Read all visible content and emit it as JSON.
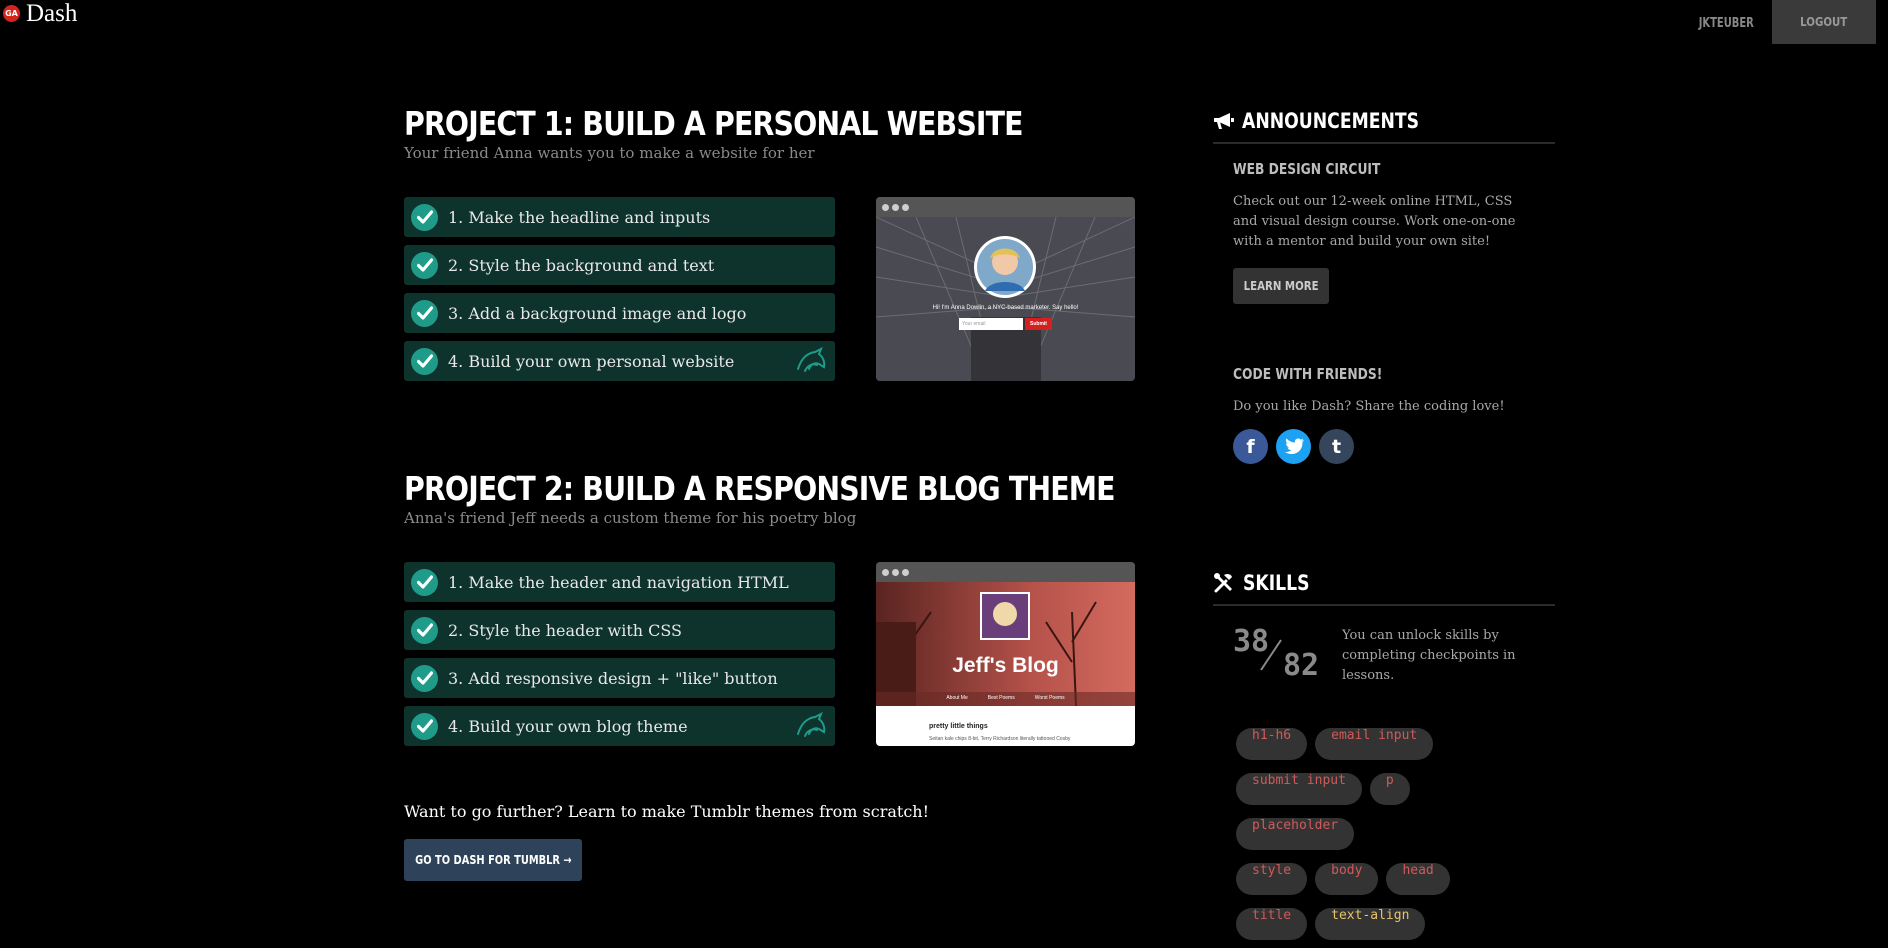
{
  "header": {
    "logo_badge": "GA",
    "logo_text": "Dash",
    "username": "JKTEUBER",
    "logout_label": "LOGOUT"
  },
  "projects": [
    {
      "title": "PROJECT 1: BUILD A PERSONAL WEBSITE",
      "subtitle": "Your friend Anna wants you to make a website for her",
      "steps": [
        {
          "label": "1. Make the headline and inputs",
          "completed": true
        },
        {
          "label": "2. Style the background and text",
          "completed": true
        },
        {
          "label": "3. Add a background image and logo",
          "completed": true
        },
        {
          "label": "4. Build your own personal website",
          "completed": true
        }
      ],
      "preview": {
        "tagline": "Hi! I'm Anna Dowlin, a NYC-based marketer. Say hello!",
        "email_placeholder": "Your email",
        "submit_label": "Submit"
      }
    },
    {
      "title": "PROJECT 2: BUILD A RESPONSIVE BLOG THEME",
      "subtitle": "Anna's friend Jeff needs a custom theme for his poetry blog",
      "steps": [
        {
          "label": "1. Make the header and navigation HTML",
          "completed": true
        },
        {
          "label": "2. Style the header with CSS",
          "completed": true
        },
        {
          "label": "3. Add responsive design + \"like\" button",
          "completed": true
        },
        {
          "label": "4. Build your own blog theme",
          "completed": true
        }
      ],
      "preview": {
        "blog_title": "Jeff's Blog",
        "nav": [
          "About Me",
          "Best Poems",
          "Worst Poems"
        ],
        "post_title": "pretty little things",
        "post_text": "Seitan kale chips 8-bit, Terry Richardson literally tattooed Cosby"
      }
    }
  ],
  "further": {
    "text": "Want to go further? Learn to make Tumblr themes from scratch!",
    "button_label": "GO TO DASH FOR TUMBLR →"
  },
  "sidebar": {
    "announcements": {
      "title": "ANNOUNCEMENTS",
      "cards": [
        {
          "title": "WEB DESIGN CIRCUIT",
          "text": "Check out our 12-week online HTML, CSS and visual design course. Work one-on-one with a mentor and build your own site!",
          "button_label": "LEARN MORE"
        },
        {
          "title": "CODE WITH FRIENDS!",
          "text": "Do you like Dash? Share the coding love!"
        }
      ],
      "social": [
        {
          "name": "facebook",
          "glyph": "f",
          "color": "#3b5998"
        },
        {
          "name": "twitter",
          "glyph": "t",
          "color": "#1da1f2"
        },
        {
          "name": "tumblr",
          "glyph": "t",
          "color": "#35465c"
        }
      ]
    },
    "skills": {
      "title": "SKILLS",
      "unlocked": "38",
      "total": "82",
      "text": "You can unlock skills by completing checkpoints in lessons.",
      "chips": [
        [
          "h1-h6",
          "email input"
        ],
        [
          "submit input",
          "p"
        ],
        [
          "placeholder"
        ],
        [
          "style",
          "body",
          "head"
        ],
        [
          "title",
          "text-align"
        ]
      ],
      "highlighted": "text-align"
    }
  },
  "colors": {
    "step_bg": "#0e332d",
    "check_bg": "#1f9b8a",
    "chip_text": "#d05a5a",
    "chip_highlight": "#e7c46b",
    "tumblr_button": "#2e4359"
  }
}
